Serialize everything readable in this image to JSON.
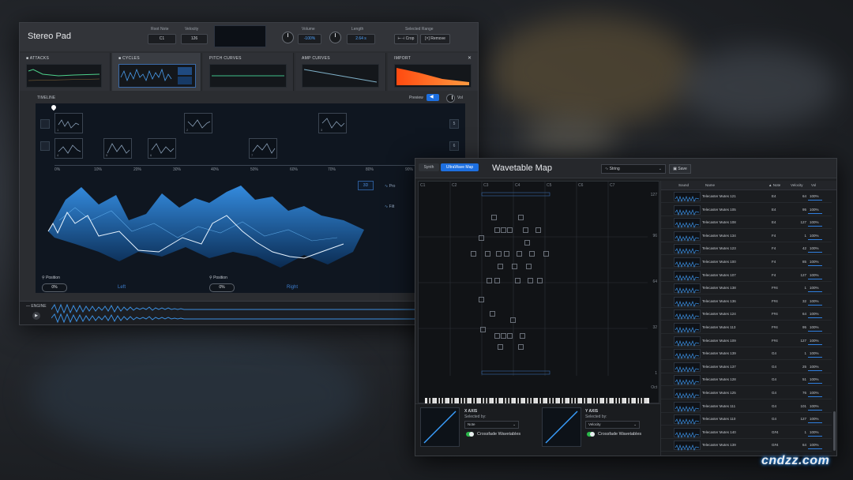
{
  "win1": {
    "title": "Stereo Pad",
    "root_note_label": "Root Note",
    "root_note_value": "C1",
    "velocity_label": "Velocity",
    "velocity_value": "126",
    "volume_label": "Volume",
    "volume_value": "-100%",
    "length_label": "Length",
    "length_value": "2.64 s",
    "range_label": "Selected Range",
    "crop_label": "Crop",
    "remove_label": "Remove",
    "tabs": [
      {
        "label": "ATTACKS"
      },
      {
        "label": "CYCLES"
      },
      {
        "label": "PITCH CURVES"
      },
      {
        "label": "AMP CURVES"
      },
      {
        "label": "IMPORT"
      }
    ],
    "timeline_label": "TIMELINE",
    "preview_label": "Preview",
    "vol_label": "Vol",
    "wt_numbers": [
      "1",
      "2",
      "3",
      "4",
      "5",
      "6",
      "7",
      "8"
    ],
    "ruler": [
      "0%",
      "10%",
      "20%",
      "30%",
      "40%",
      "50%",
      "60%",
      "70%",
      "80%",
      "90%"
    ],
    "side_buttons": [
      "5",
      "6"
    ],
    "mode_3d": "3D",
    "ctl_labels": [
      "Pro",
      "Filt"
    ],
    "position_label": "Position",
    "left_pos_value": "0%",
    "right_pos_value": "0%",
    "left_label": "Left",
    "right_label": "Right",
    "engine_label": "ENGINE"
  },
  "win2": {
    "synth_tab": "Synth",
    "ultrawave_tab": "UltraWave Map",
    "title": "Wavetable Map",
    "selector_value": "String",
    "save_label": "Save",
    "octaves": [
      "C1",
      "C2",
      "C3",
      "C4",
      "C5",
      "C6",
      "C7"
    ],
    "vel_ticks": [
      "127",
      "96",
      "64",
      "32",
      "1"
    ],
    "oct_label": "Oct",
    "x_axis": {
      "title": "X AXIS",
      "sub": "Selected by:",
      "value": "Note",
      "toggle_label": "Crossfade Wavetables"
    },
    "y_axis": {
      "title": "Y AXIS",
      "sub": "Selected by:",
      "value": "Velocity",
      "toggle_label": "Crossfade Wavetables"
    },
    "list_headers": {
      "sound": "Sound",
      "name": "Name",
      "note": "Note",
      "velocity": "Velocity",
      "vol": "Vol"
    },
    "rows": [
      {
        "name": "Telecaster Mutes 121",
        "note": "E4",
        "vel": "64",
        "vol": "100%"
      },
      {
        "name": "Telecaster Mutes 105",
        "note": "E4",
        "vel": "95",
        "vol": "100%"
      },
      {
        "name": "Telecaster Mutes 108",
        "note": "E4",
        "vel": "127",
        "vol": "100%"
      },
      {
        "name": "Telecaster Mutes 134",
        "note": "F4",
        "vel": "1",
        "vol": "100%"
      },
      {
        "name": "Telecaster Mutes 123",
        "note": "F4",
        "vel": "42",
        "vol": "100%"
      },
      {
        "name": "Telecaster Mutes 100",
        "note": "F4",
        "vel": "85",
        "vol": "100%"
      },
      {
        "name": "Telecaster Mutes 107",
        "note": "F4",
        "vel": "127",
        "vol": "100%"
      },
      {
        "name": "Telecaster Mutes 138",
        "note": "F#4",
        "vel": "1",
        "vol": "100%"
      },
      {
        "name": "Telecaster Mutes 136",
        "note": "F#4",
        "vel": "32",
        "vol": "100%"
      },
      {
        "name": "Telecaster Mutes 124",
        "note": "F#4",
        "vel": "64",
        "vol": "100%"
      },
      {
        "name": "Telecaster Mutes 113",
        "note": "F#4",
        "vel": "95",
        "vol": "100%"
      },
      {
        "name": "Telecaster Mutes 109",
        "note": "F#4",
        "vel": "127",
        "vol": "100%"
      },
      {
        "name": "Telecaster Mutes 139",
        "note": "G4",
        "vel": "1",
        "vol": "100%"
      },
      {
        "name": "Telecaster Mutes 137",
        "note": "G4",
        "vel": "25",
        "vol": "100%"
      },
      {
        "name": "Telecaster Mutes 128",
        "note": "G4",
        "vel": "51",
        "vol": "100%"
      },
      {
        "name": "Telecaster Mutes 125",
        "note": "G4",
        "vel": "76",
        "vol": "100%"
      },
      {
        "name": "Telecaster Mutes 111",
        "note": "G4",
        "vel": "101",
        "vol": "100%"
      },
      {
        "name": "Telecaster Mutes 110",
        "note": "G4",
        "vel": "127",
        "vol": "100%"
      },
      {
        "name": "Telecaster Mutes 140",
        "note": "G#4",
        "vel": "1",
        "vol": "100%"
      },
      {
        "name": "Telecaster Mutes 139",
        "note": "G#4",
        "vel": "64",
        "vol": "100%"
      }
    ]
  },
  "watermark": "cndzz.com",
  "colors": {
    "accent": "#1d6fe0",
    "wave": "#2a8fe8",
    "toggle_on": "#2ab74a",
    "import_orange": "#ff6a1a"
  }
}
